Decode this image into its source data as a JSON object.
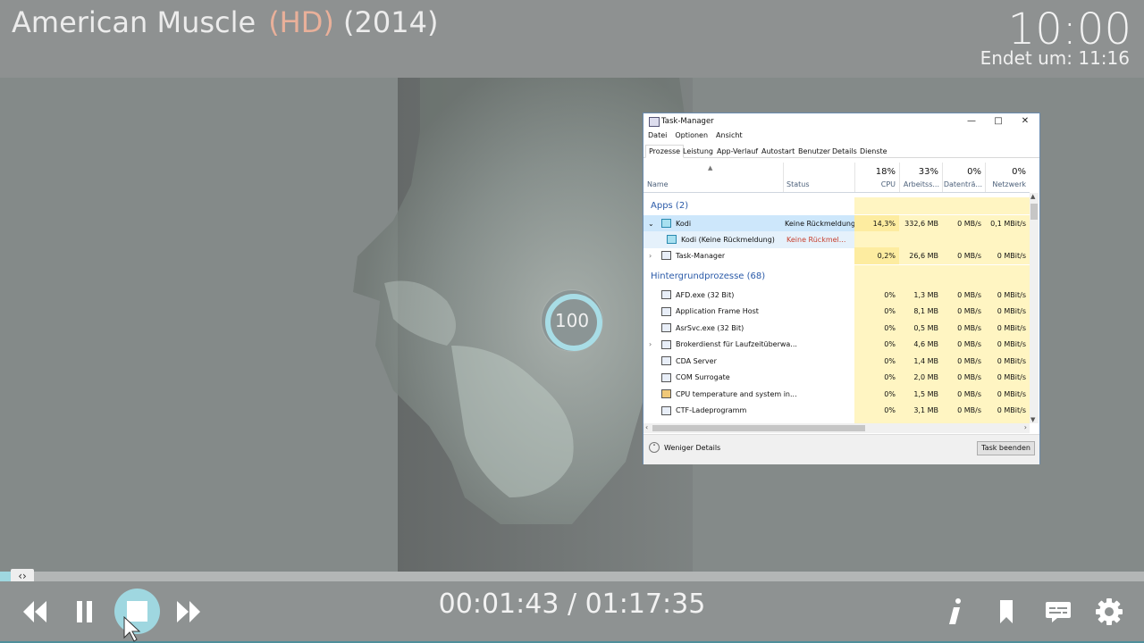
{
  "player": {
    "title": "American Muscle",
    "quality": "(HD)",
    "year": "(2014)",
    "clock": "10:00",
    "end_time": "Endet um: 11:16",
    "busy_value": "100",
    "elapsed_total": "00:01:43 / 01:17:35",
    "progress_fraction": 0.022,
    "accent": "#9fd7e0",
    "controls": {
      "rewind": "rewind-icon",
      "pause": "pause-icon",
      "stop": "stop-icon",
      "forward": "fast-forward-icon",
      "info": "info-icon",
      "bookmark": "bookmark-icon",
      "subtitles": "subtitles-icon",
      "settings": "gear-icon"
    }
  },
  "taskmanager": {
    "title": "Task-Manager",
    "menu": [
      "Datei",
      "Optionen",
      "Ansicht"
    ],
    "tabs": [
      "Prozesse",
      "Leistung",
      "App-Verlauf",
      "Autostart",
      "Benutzer",
      "Details",
      "Dienste"
    ],
    "columns": {
      "name": "Name",
      "status": "Status",
      "cpu_pct": "18%",
      "cpu": "CPU",
      "mem_pct": "33%",
      "mem": "Arbeitss...",
      "disk_pct": "0%",
      "disk": "Datenträ...",
      "net_pct": "0%",
      "net": "Netzwerk"
    },
    "groups": {
      "apps": "Apps (2)",
      "background": "Hintergrundprozesse (68)"
    },
    "rows": [
      {
        "name": "Kodi",
        "status": "Keine Rückmeldung",
        "cpu": "14,3%",
        "mem": "332,6 MB",
        "disk": "0 MB/s",
        "net": "0,1 MBit/s"
      },
      {
        "name": "Kodi (Keine Rückmeldung)",
        "status": "Keine Rückmel...",
        "cpu": "",
        "mem": "",
        "disk": "",
        "net": ""
      },
      {
        "name": "Task-Manager",
        "status": "",
        "cpu": "0,2%",
        "mem": "26,6 MB",
        "disk": "0 MB/s",
        "net": "0 MBit/s"
      },
      {
        "name": "AFD.exe (32 Bit)",
        "status": "",
        "cpu": "0%",
        "mem": "1,3 MB",
        "disk": "0 MB/s",
        "net": "0 MBit/s"
      },
      {
        "name": "Application Frame Host",
        "status": "",
        "cpu": "0%",
        "mem": "8,1 MB",
        "disk": "0 MB/s",
        "net": "0 MBit/s"
      },
      {
        "name": "AsrSvc.exe (32 Bit)",
        "status": "",
        "cpu": "0%",
        "mem": "0,5 MB",
        "disk": "0 MB/s",
        "net": "0 MBit/s"
      },
      {
        "name": "Brokerdienst für Laufzeitüberwa...",
        "status": "",
        "cpu": "0%",
        "mem": "4,6 MB",
        "disk": "0 MB/s",
        "net": "0 MBit/s"
      },
      {
        "name": "CDA Server",
        "status": "",
        "cpu": "0%",
        "mem": "1,4 MB",
        "disk": "0 MB/s",
        "net": "0 MBit/s"
      },
      {
        "name": "COM Surrogate",
        "status": "",
        "cpu": "0%",
        "mem": "2,0 MB",
        "disk": "0 MB/s",
        "net": "0 MBit/s"
      },
      {
        "name": "CPU temperature and system in...",
        "status": "",
        "cpu": "0%",
        "mem": "1,5 MB",
        "disk": "0 MB/s",
        "net": "0 MBit/s"
      },
      {
        "name": "CTF-Ladeprogramm",
        "status": "",
        "cpu": "0%",
        "mem": "3,1 MB",
        "disk": "0 MB/s",
        "net": "0 MBit/s"
      }
    ],
    "less_details": "Weniger Details",
    "end_task": "Task beenden"
  }
}
